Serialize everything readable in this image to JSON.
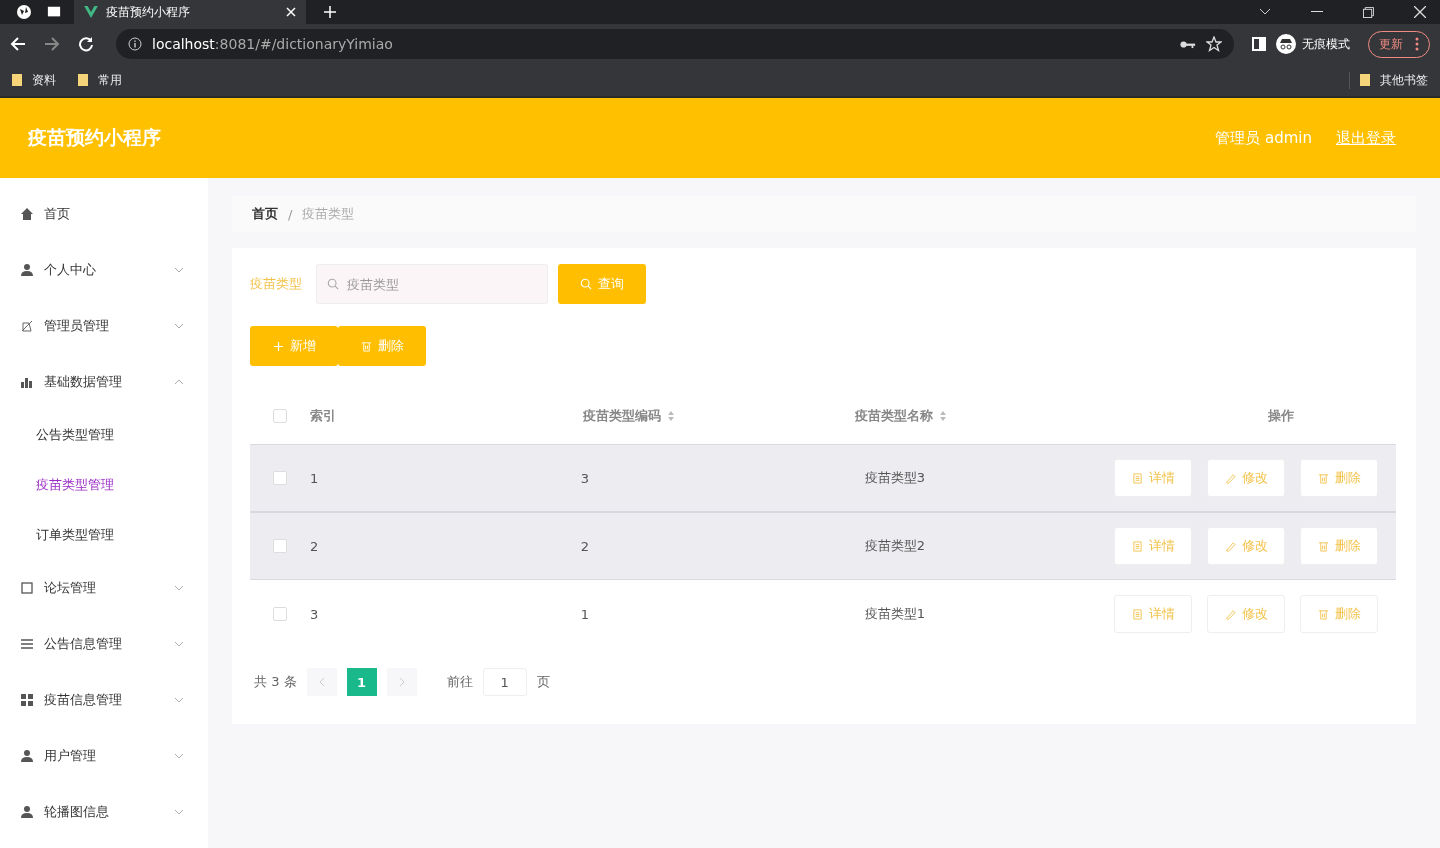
{
  "browser": {
    "tab_title": "疫苗预约小程序",
    "url_host": "localhost",
    "url_rest": ":8081/#/dictionaryYimiao",
    "incognito_label": "无痕模式",
    "update_label": "更新",
    "bookmarks": [
      "资料",
      "常用"
    ],
    "other_bookmarks": "其他书签"
  },
  "header": {
    "title": "疫苗预约小程序",
    "user": "管理员 admin",
    "logout": "退出登录"
  },
  "sidebar": {
    "items": [
      {
        "label": "首页"
      },
      {
        "label": "个人中心",
        "expanded": false
      },
      {
        "label": "管理员管理",
        "expanded": false
      },
      {
        "label": "基础数据管理",
        "expanded": true,
        "children": [
          {
            "label": "公告类型管理",
            "selected": false
          },
          {
            "label": "疫苗类型管理",
            "selected": true
          },
          {
            "label": "订单类型管理",
            "selected": false
          }
        ]
      },
      {
        "label": "论坛管理",
        "expanded": false
      },
      {
        "label": "公告信息管理",
        "expanded": false
      },
      {
        "label": "疫苗信息管理",
        "expanded": false
      },
      {
        "label": "用户管理",
        "expanded": false
      },
      {
        "label": "轮播图信息",
        "expanded": false
      }
    ]
  },
  "breadcrumb": {
    "items": [
      "首页",
      "疫苗类型"
    ],
    "separator": "/"
  },
  "search": {
    "label": "疫苗类型",
    "placeholder": "疫苗类型",
    "button": "查询"
  },
  "actions": [
    "新增",
    "删除"
  ],
  "table": {
    "header_checked": false,
    "columns": [
      {
        "label": "索引",
        "sortable": false
      },
      {
        "label": "疫苗类型编码",
        "sortable": true
      },
      {
        "label": "疫苗类型名称",
        "sortable": true
      },
      {
        "label": "操作",
        "sortable": false
      }
    ],
    "rows": [
      {
        "checked": false,
        "highlighted": true,
        "index": "1",
        "code": "3",
        "name": "疫苗类型3",
        "buttons": [
          "详情",
          "修改",
          "删除"
        ]
      },
      {
        "checked": false,
        "highlighted": true,
        "index": "2",
        "code": "2",
        "name": "疫苗类型2",
        "buttons": [
          "详情",
          "修改",
          "删除"
        ]
      },
      {
        "checked": false,
        "highlighted": false,
        "index": "3",
        "code": "1",
        "name": "疫苗类型1",
        "buttons": [
          "详情",
          "修改",
          "删除"
        ]
      }
    ]
  },
  "pagination": {
    "total": "共 3 条",
    "pages": [
      {
        "label": "1",
        "selected": true
      }
    ],
    "goto": "前往",
    "goto_value": "1",
    "page_suffix": "页"
  }
}
